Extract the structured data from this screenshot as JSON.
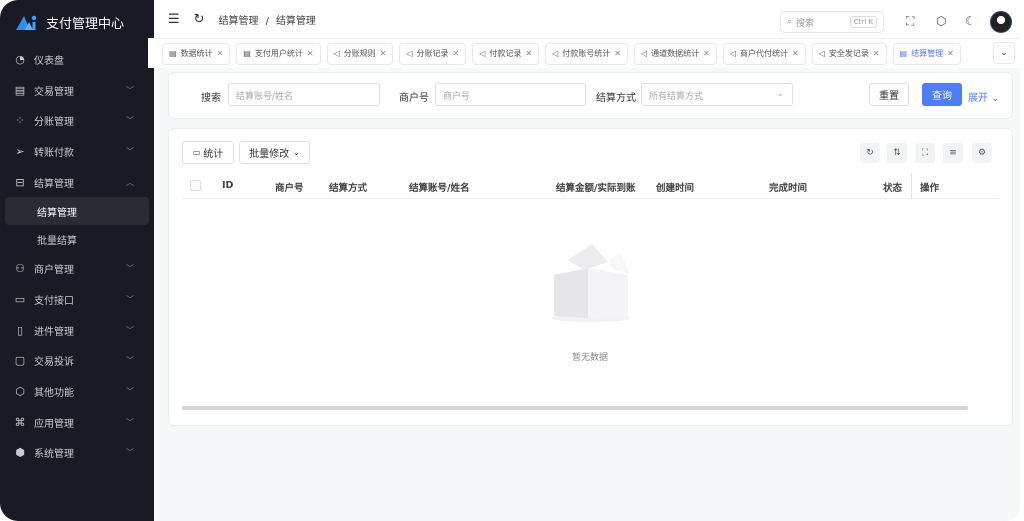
{
  "app": {
    "title": "支付管理中心"
  },
  "sidebar": {
    "items": [
      {
        "label": "仪表盘",
        "icon": "pie-chart-icon"
      },
      {
        "label": "交易管理",
        "icon": "document-icon",
        "chevron": "down"
      },
      {
        "label": "分账管理",
        "icon": "split-icon",
        "chevron": "down"
      },
      {
        "label": "转账付款",
        "icon": "send-icon",
        "chevron": "down"
      },
      {
        "label": "结算管理",
        "icon": "settlement-icon",
        "chevron": "up",
        "children": [
          {
            "label": "结算管理",
            "active": true
          },
          {
            "label": "批量结算"
          }
        ]
      },
      {
        "label": "商户管理",
        "icon": "user-icon",
        "chevron": "down"
      },
      {
        "label": "支付接口",
        "icon": "card-icon",
        "chevron": "down"
      },
      {
        "label": "进件管理",
        "icon": "file-icon",
        "chevron": "down"
      },
      {
        "label": "交易投诉",
        "icon": "message-icon",
        "chevron": "down"
      },
      {
        "label": "其他功能",
        "icon": "box-icon",
        "chevron": "down"
      },
      {
        "label": "应用管理",
        "icon": "apps-icon",
        "chevron": "down"
      },
      {
        "label": "系统管理",
        "icon": "settings-icon",
        "chevron": "down"
      }
    ]
  },
  "header": {
    "breadcrumb": [
      "结算管理",
      "结算管理"
    ],
    "search_placeholder": "搜索",
    "shortcut": "Ctrl K"
  },
  "tabs": [
    {
      "label": "数据统计"
    },
    {
      "label": "支付用户统计"
    },
    {
      "label": "分账规则"
    },
    {
      "label": "分账记录"
    },
    {
      "label": "付款记录"
    },
    {
      "label": "付款账号统计"
    },
    {
      "label": "通道数据统计"
    },
    {
      "label": "商户代付统计"
    },
    {
      "label": "安全发记录"
    },
    {
      "label": "结算管理",
      "active": true
    }
  ],
  "filters": {
    "search_label": "搜索",
    "search_placeholder": "结算账号/姓名",
    "merchant_label": "商户号",
    "merchant_placeholder": "商户号",
    "method_label": "结算方式",
    "method_placeholder": "所有结算方式",
    "reset": "重置",
    "query": "查询",
    "expand": "展开"
  },
  "toolbar": {
    "stats": "统计",
    "batch_edit": "批量修改"
  },
  "table": {
    "columns": [
      "ID",
      "商户号",
      "结算方式",
      "结算账号/姓名",
      "结算金额/实际到账",
      "创建时间",
      "完成时间",
      "状态",
      "操作"
    ],
    "rows": [],
    "empty_text": "暂无数据"
  },
  "colors": {
    "primary": "#4f7cf7",
    "sidebar_bg": "#191a23"
  }
}
